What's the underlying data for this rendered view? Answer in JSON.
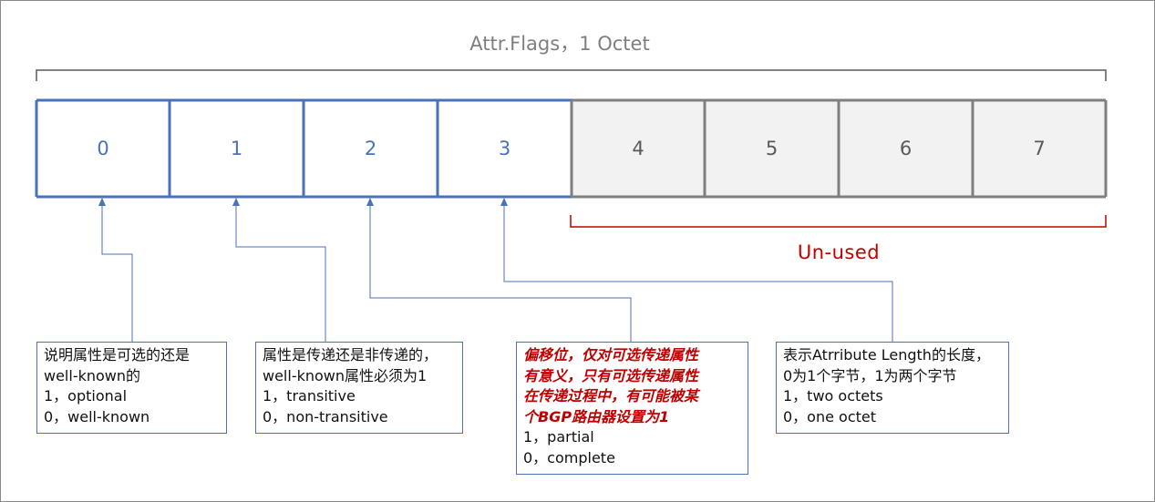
{
  "title": "Attr.Flags，1 Octet",
  "bits": [
    "0",
    "1",
    "2",
    "3",
    "4",
    "5",
    "6",
    "7"
  ],
  "used_color": "#4a72b8",
  "unused_color": "#595959",
  "unused_fill": "#f2f2f2",
  "unused_label": "Un-used",
  "unused_label_color": "#c00000",
  "notes": [
    {
      "lines": [
        "说明属性是可选的还是",
        "well-known的",
        "1，optional",
        "0，well-known"
      ]
    },
    {
      "lines": [
        "属性是传递还是非传递的，",
        "well-known属性必须为1",
        "1，transitive",
        "0，non-transitive"
      ]
    },
    {
      "red_lines": [
        "偏移位，仅对可选传递属性",
        "有意义，只有可选传递属性",
        "在传递过程中，有可能被某",
        "个BGP路由器设置为1"
      ],
      "lines": [
        "1，partial",
        "0，complete"
      ]
    },
    {
      "lines": [
        "表示Atrribute Length的长度，",
        "0为1个字节，1为两个字节",
        "1，two octets",
        "0，one octet"
      ]
    }
  ]
}
